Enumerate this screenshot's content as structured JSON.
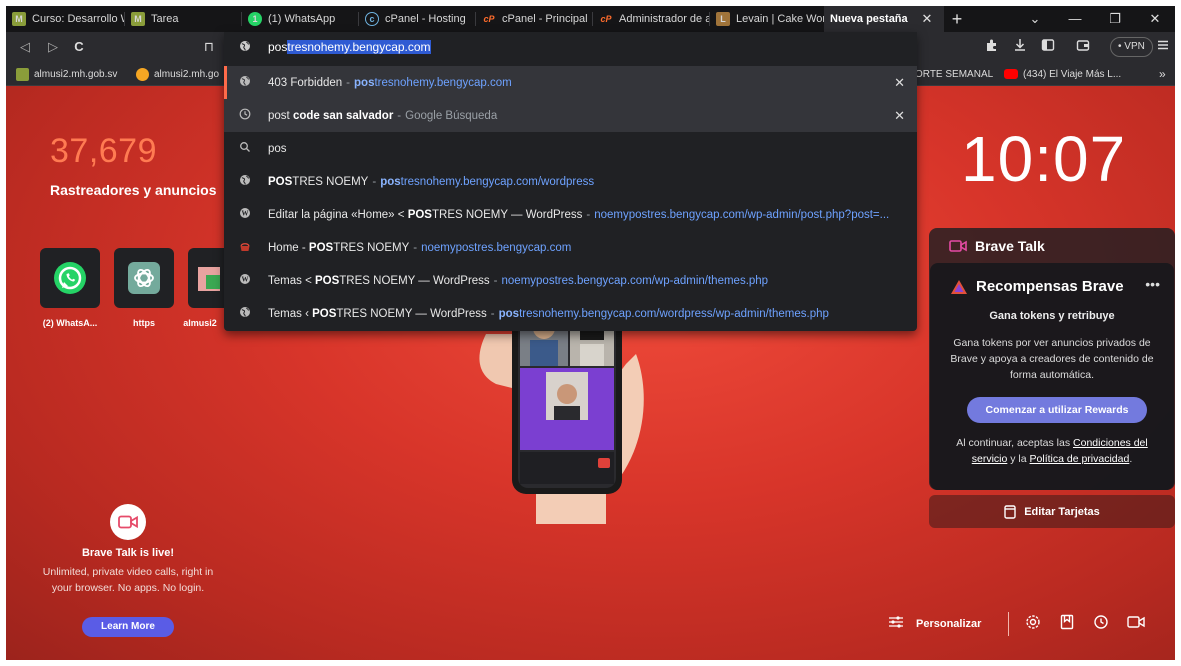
{
  "tabs": [
    {
      "label": "Curso: Desarrollo W",
      "fav_color": "#8a9d3a",
      "fav_text": "M"
    },
    {
      "label": "Tarea",
      "fav_color": "#8a9d3a",
      "fav_text": "M"
    },
    {
      "label": "(1) WhatsApp",
      "fav_color": "#25d366",
      "fav_text": "1"
    },
    {
      "label": "cPanel - Hosting",
      "fav_color": "#6fb3e0",
      "fav_text": "c"
    },
    {
      "label": "cPanel - Principal",
      "fav_color": "#ff6c2c",
      "fav_text": "cP"
    },
    {
      "label": "Administrador de a",
      "fav_color": "#ff6c2c",
      "fav_text": "cP"
    },
    {
      "label": "Levain | Cake Word",
      "fav_color": "#a0743a",
      "fav_text": "L"
    },
    {
      "label": "Nueva pestaña",
      "active": true
    }
  ],
  "tab_close": "✕",
  "new_tab": "+",
  "window": {
    "chevron": "⌄",
    "minimize": "—",
    "restore": "❐",
    "close": "✕"
  },
  "toolbar": {
    "back": "◁",
    "forward": "▷",
    "reload": "C",
    "bookmark": "⊓",
    "vpn": "• VPN"
  },
  "bookmarks": [
    {
      "label": "almusi2.mh.gob.sv",
      "color": "#8a9d3a"
    },
    {
      "label": "almusi2.mh.go",
      "color": "#f5a623"
    },
    {
      "label": "ORTE SEMANAL",
      "color": ""
    },
    {
      "label": "(434) El Viaje Más L...",
      "color": "#ff0000"
    }
  ],
  "bookmarks_more": "»",
  "omnibox": {
    "typed": "pos",
    "completion": "tresnohemy.bengycap.com",
    "rows": [
      {
        "icon": "globe",
        "title_plain": "403 Forbidden",
        "url_bold": "pos",
        "url_rest": "tresnohemy.bengycap.com",
        "highlight": true,
        "removable": true
      },
      {
        "icon": "history",
        "title_plain": "post",
        "title_bold": " code san salvador",
        "suffix": "Google Búsqueda",
        "highlight": true,
        "removable": true
      },
      {
        "icon": "search",
        "title_plain": "pos"
      },
      {
        "icon": "globe",
        "title_bold": "POS",
        "title_plain": "TRES NOEMY",
        "url_bold": "pos",
        "url_rest": "tresnohemy.bengycap.com/wordpress"
      },
      {
        "icon": "wp",
        "title_plain": "Editar la página «Home» < ",
        "title_bold": "POS",
        "title_plain2": "TRES NOEMY — WordPress",
        "url_rest": "noemypostres.bengycap.com/wp-admin/post.php?post=..."
      },
      {
        "icon": "cake",
        "title_plain": "Home - ",
        "title_bold": "POS",
        "title_plain2": "TRES NOEMY",
        "url_rest": "noemypostres.bengycap.com"
      },
      {
        "icon": "wp",
        "title_plain": "Temas < ",
        "title_bold": "POS",
        "title_plain2": "TRES NOEMY — WordPress",
        "url_rest": "noemypostres.bengycap.com/wp-admin/themes.php"
      },
      {
        "icon": "globe",
        "title_plain": "Temas ‹ ",
        "title_bold": "POS",
        "title_plain2": "TRES NOEMY — WordPress",
        "url_bold": "pos",
        "url_rest": "tresnohemy.bengycap.com/wordpress/wp-admin/themes.php"
      }
    ]
  },
  "ntp": {
    "stats_count": "37,679",
    "stats_label": "Rastreadores y anuncios",
    "clock": "10:07",
    "tiles": [
      {
        "label": "(2) WhatsA..."
      },
      {
        "label": "https"
      },
      {
        "label": "almusi2"
      }
    ],
    "talk_widget": {
      "title": "Brave Talk"
    },
    "rewards": {
      "title": "Recompensas Brave",
      "more": "•••",
      "subtitle": "Gana tokens y retribuye",
      "description": "Gana tokens por ver anuncios privados de Brave y apoya a creadores de contenido de forma automática.",
      "button": "Comenzar a utilizar Rewards",
      "terms_prefix": "Al continuar, aceptas las ",
      "terms_link": "Condiciones del servicio",
      "terms_mid": " y la ",
      "privacy_link": "Política de privacidad",
      "terms_suffix": "."
    },
    "edit_cards": "Editar Tarjetas",
    "talk_promo": {
      "title": "Brave Talk is live!",
      "description": "Unlimited, private video calls, right in your browser. No apps. No login.",
      "button": "Learn More"
    },
    "customize": "Personalizar"
  },
  "colors": {
    "accent": "#ff6b4a",
    "rewards_button": "#737ade",
    "talk_button": "#5a5ce6",
    "link": "#6ea2ff"
  }
}
